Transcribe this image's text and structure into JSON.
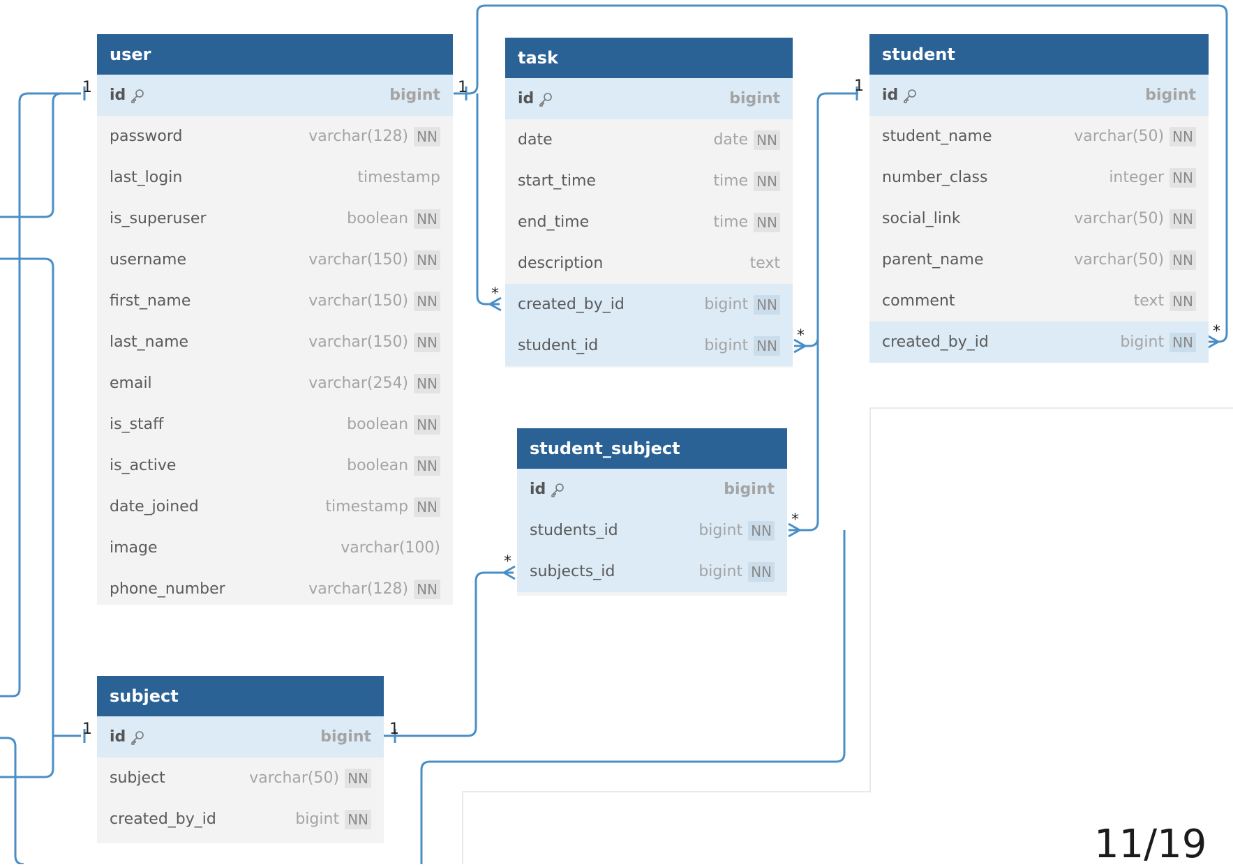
{
  "page_number": "11/19",
  "colors": {
    "header": "#2a6296",
    "connector": "#4a8ec6",
    "highlight_row": "#dcebf6"
  },
  "tables": {
    "user": {
      "name": "user",
      "pk": {
        "name": "id",
        "type": "bigint"
      },
      "columns": [
        {
          "name": "password",
          "type": "varchar(128)",
          "nn": "NN"
        },
        {
          "name": "last_login",
          "type": "timestamp",
          "nn": ""
        },
        {
          "name": "is_superuser",
          "type": "boolean",
          "nn": "NN"
        },
        {
          "name": "username",
          "type": "varchar(150)",
          "nn": "NN"
        },
        {
          "name": "first_name",
          "type": "varchar(150)",
          "nn": "NN"
        },
        {
          "name": "last_name",
          "type": "varchar(150)",
          "nn": "NN"
        },
        {
          "name": "email",
          "type": "varchar(254)",
          "nn": "NN"
        },
        {
          "name": "is_staff",
          "type": "boolean",
          "nn": "NN"
        },
        {
          "name": "is_active",
          "type": "boolean",
          "nn": "NN"
        },
        {
          "name": "date_joined",
          "type": "timestamp",
          "nn": "NN"
        },
        {
          "name": "image",
          "type": "varchar(100)",
          "nn": ""
        },
        {
          "name": "phone_number",
          "type": "varchar(128)",
          "nn": "NN"
        }
      ]
    },
    "task": {
      "name": "task",
      "pk": {
        "name": "id",
        "type": "bigint"
      },
      "columns": [
        {
          "name": "date",
          "type": "date",
          "nn": "NN"
        },
        {
          "name": "start_time",
          "type": "time",
          "nn": "NN"
        },
        {
          "name": "end_time",
          "type": "time",
          "nn": "NN"
        },
        {
          "name": "description",
          "type": "text",
          "nn": ""
        },
        {
          "name": "created_by_id",
          "type": "bigint",
          "nn": "NN"
        },
        {
          "name": "student_id",
          "type": "bigint",
          "nn": "NN"
        }
      ]
    },
    "student": {
      "name": "student",
      "pk": {
        "name": "id",
        "type": "bigint"
      },
      "columns": [
        {
          "name": "student_name",
          "type": "varchar(50)",
          "nn": "NN"
        },
        {
          "name": "number_class",
          "type": "integer",
          "nn": "NN"
        },
        {
          "name": "social_link",
          "type": "varchar(50)",
          "nn": "NN"
        },
        {
          "name": "parent_name",
          "type": "varchar(50)",
          "nn": "NN"
        },
        {
          "name": "comment",
          "type": "text",
          "nn": "NN"
        },
        {
          "name": "created_by_id",
          "type": "bigint",
          "nn": "NN"
        }
      ]
    },
    "student_subject": {
      "name": "student_subject",
      "pk": {
        "name": "id",
        "type": "bigint"
      },
      "columns": [
        {
          "name": "students_id",
          "type": "bigint",
          "nn": "NN"
        },
        {
          "name": "subjects_id",
          "type": "bigint",
          "nn": "NN"
        }
      ]
    },
    "subject": {
      "name": "subject",
      "pk": {
        "name": "id",
        "type": "bigint"
      },
      "columns": [
        {
          "name": "subject",
          "type": "varchar(50)",
          "nn": "NN"
        },
        {
          "name": "created_by_id",
          "type": "bigint",
          "nn": "NN"
        }
      ]
    }
  },
  "cardinality": {
    "one": "1",
    "many": "*"
  }
}
